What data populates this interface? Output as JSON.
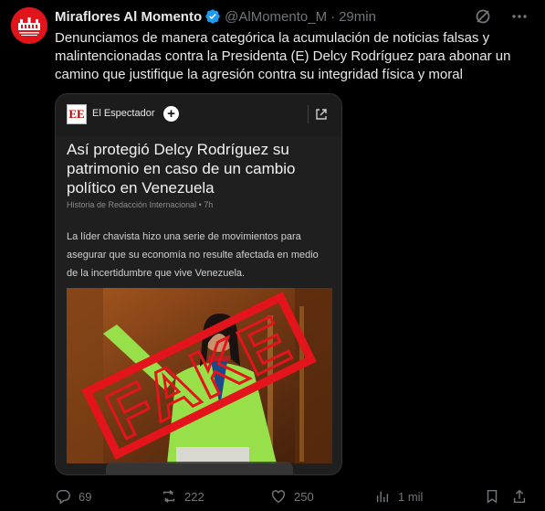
{
  "author": {
    "name": "Miraflores Al Momento",
    "handle": "@AlMomento_M",
    "separator": "·",
    "time": "29min",
    "avatar_icon": "miraflores-palace-logo",
    "verified_icon": "verified-badge-icon"
  },
  "tweet": {
    "text": "Denunciamos de manera categórica la acumulación de noticias falsas y malintencionadas contra la Presidenta (E) Delcy Rodríguez para abonar un camino que justifique la agresión contra su integridad física y moral"
  },
  "top_icons": [
    "grok-icon",
    "more-icon"
  ],
  "card": {
    "source_name": "El Espectador",
    "source_logo": "EE",
    "follow_symbol": "+",
    "headline": "Así protegió Delcy Rodríguez su patrimonio en caso de un cambio político en Venezuela",
    "byline": "Historia de Redacción Internacional • 7h",
    "lede": "La líder chavista hizo una serie de movimientos para asegurar que su economía no resulte afectada en medio de la incertidumbre que vive Venezuela.",
    "stamp_text": "FAKE"
  },
  "actions": {
    "replies": "69",
    "reposts": "222",
    "likes": "250",
    "views": "1 mil"
  },
  "colors": {
    "background": "#000000",
    "text": "#e7e9ea",
    "muted": "#71767b",
    "verified": "#1d9bf0",
    "avatar": "#e0151b",
    "stamp": "#e3141b"
  }
}
